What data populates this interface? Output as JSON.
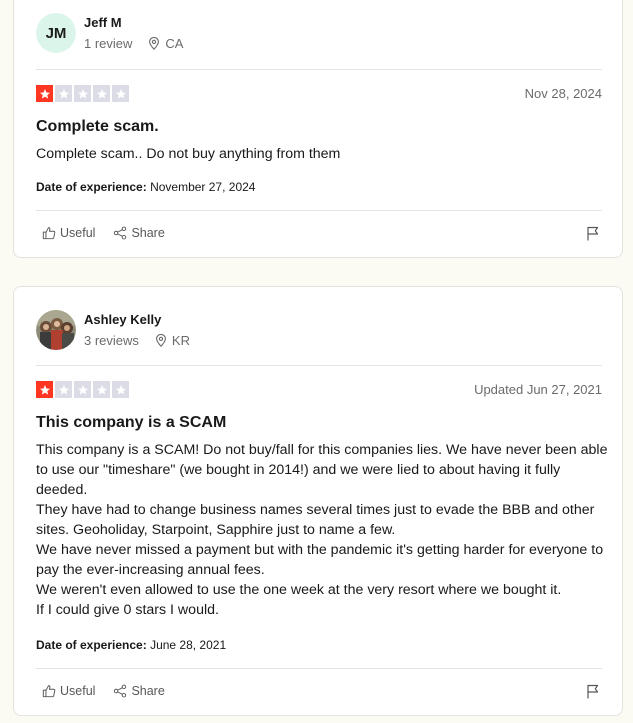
{
  "reviews": [
    {
      "reviewer": {
        "initials": "JM",
        "name": "Jeff M",
        "count": "1 review",
        "location": "CA"
      },
      "rating": 1,
      "date": "Nov 28, 2024",
      "title": "Complete scam.",
      "body": [
        "Complete scam.. Do not buy anything from them"
      ],
      "experience_label": "Date of experience:",
      "experience_date": "November 27, 2024",
      "useful_label": "Useful",
      "share_label": "Share"
    },
    {
      "reviewer": {
        "initials": "",
        "name": "Ashley Kelly",
        "count": "3 reviews",
        "location": "KR"
      },
      "rating": 1,
      "date": "Updated Jun 27, 2021",
      "title": "This company is a SCAM",
      "body": [
        "This company is a SCAM! Do not buy/fall for this companies lies. We have never been able to use our \"timeshare\" (we bought in 2014!) and we were lied to about having it fully deeded.",
        "They have had to change business names several times just to evade the BBB and other sites. Geoholiday, Starpoint, Sapphire just to name a few.",
        "We have never missed a payment but with the pandemic it's getting harder for everyone to pay the ever-increasing annual fees.",
        "We weren't even allowed to use the one week at the very resort where we bought it.",
        "If I could give 0 stars I would."
      ],
      "experience_label": "Date of experience:",
      "experience_date": "June 28, 2021",
      "useful_label": "Useful",
      "share_label": "Share"
    }
  ],
  "colors": {
    "star_active": "#ff3722",
    "star_inactive": "#dcdce6",
    "avatar_bg": "#dcf5ea"
  },
  "icons": {
    "location": "location-pin-icon",
    "useful": "thumbs-up-icon",
    "share": "share-icon",
    "flag": "flag-icon",
    "star": "star-icon"
  }
}
